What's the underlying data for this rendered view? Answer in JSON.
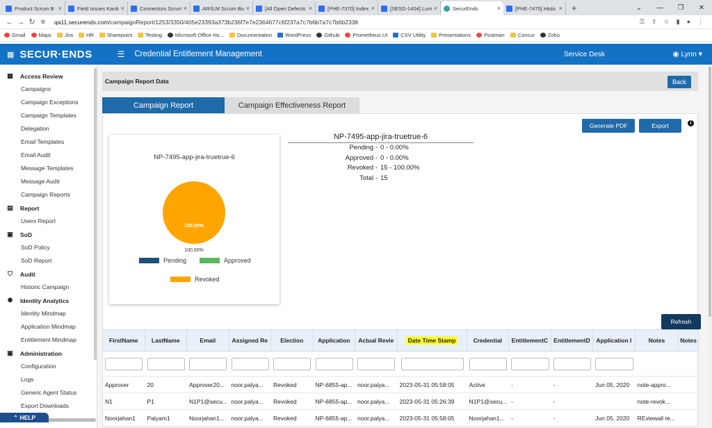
{
  "browser": {
    "tabs": [
      {
        "title": "Product Scrum B",
        "active": false
      },
      {
        "title": "Field Issues Kanb",
        "active": false
      },
      {
        "title": "Connectors Scrum",
        "active": false
      },
      {
        "title": "AR/ILM Scrum Bo",
        "active": false
      },
      {
        "title": "[All Open Defects",
        "active": false
      },
      {
        "title": "[PHE-7370] Index",
        "active": false
      },
      {
        "title": "[SESD-1404] Lum",
        "active": false
      },
      {
        "title": "SecurEnds",
        "active": true
      },
      {
        "title": "[PHE-7475] Histo",
        "active": false
      }
    ],
    "url_domain": "qa11.securends.com",
    "url_path": "/campaignReport/1253/3350/405e23393a373b236f7e7e2364677c6f237a7c7b6b7a7c7b6b2338",
    "bookmarks": [
      "Gmail",
      "Maps",
      "Jira",
      "HR",
      "Sharepoint",
      "Testing",
      "Microsoft Office Ho...",
      "Documentation",
      "WordPress",
      "Github",
      "Prometheus UI",
      "CSV Utility",
      "Presentations",
      "Postman",
      "Concur",
      "Zoho"
    ]
  },
  "header": {
    "logo": "SECUR·ENDS",
    "title": "Credential Entitlement Management",
    "service_desk": "Service Desk",
    "user": "Lynn"
  },
  "sidebar": {
    "sections": [
      {
        "label": "Access Review",
        "icon": "grid-icon",
        "items": [
          "Campaigns",
          "Campaign Exceptions",
          "Campaign Templates",
          "Delegation",
          "Email Templates",
          "Email Audit",
          "Message Templates",
          "Message Audit",
          "Campaign Reports"
        ]
      },
      {
        "label": "Report",
        "icon": "report-icon",
        "items": [
          "Users Report"
        ]
      },
      {
        "label": "SoD",
        "icon": "sod-icon",
        "items": [
          "SoD Policy",
          "SoD Report"
        ]
      },
      {
        "label": "Audit",
        "icon": "shield-icon",
        "items": [
          "Historic Campaign"
        ]
      },
      {
        "label": "Identity Analytics",
        "icon": "analytics-icon",
        "items": [
          "Identity Mindmap",
          "Application Mindmap",
          "Entitlement Mindmap"
        ]
      },
      {
        "label": "Administration",
        "icon": "admin-icon",
        "items": [
          "Configuration",
          "Logs",
          "Generic Agent Status",
          "Export Downloads"
        ]
      }
    ],
    "help": "HELP"
  },
  "page": {
    "section_title": "Campaign Report Data",
    "back_label": "Back",
    "tabs": [
      "Campaign Report",
      "Campaign Effectiveness Report"
    ],
    "generate_pdf": "Generate PDF",
    "export": "Export",
    "refresh": "Refresh"
  },
  "chart_data": {
    "type": "pie",
    "title": "NP-7495-app-jira-truetrue-6",
    "slices": [
      {
        "name": "Pending",
        "value": 0,
        "color": "#1f4e79"
      },
      {
        "name": "Approved",
        "value": 0,
        "color": "#5cb85c"
      },
      {
        "name": "Revoked",
        "value": 100,
        "color": "#ffa500"
      }
    ],
    "inner_label": "100.00%",
    "outer_label": "100.00%"
  },
  "summary": {
    "title": "NP-7495-app-jira-truetrue-6",
    "rows": [
      {
        "k": "Pending -",
        "v": "0 - 0.00%"
      },
      {
        "k": "Approved -",
        "v": "0 - 0.00%"
      },
      {
        "k": "Revoked -",
        "v": "15 - 100.00%"
      },
      {
        "k": "Total -",
        "v": "15"
      }
    ]
  },
  "table": {
    "columns": [
      "FirstName",
      "LastName",
      "Email",
      "Assigned Re",
      "Election",
      "Application",
      "Actual Revie",
      "Date Time Stamp",
      "Credential",
      "EntitlementC",
      "EntitlementD",
      "Application I",
      "Notes",
      "Notes"
    ],
    "rows": [
      [
        "Approver",
        "20",
        "Approver20...",
        "noor.palya...",
        "Revoked",
        "NP-6855-ap...",
        "noor.palya...",
        "2023-05-31 05:58:05",
        "Active",
        "-",
        "-",
        "Jun 05, 2020",
        "note-appro...",
        ""
      ],
      [
        "N1",
        "P1",
        "N1P1@secu...",
        "noor.palya...",
        "Revoked",
        "NP-6855-ap...",
        "noor.palya...",
        "2023-05-31 05:26:39",
        "N1P1@secu...",
        "-",
        "-",
        "",
        "note-revok...",
        ""
      ],
      [
        "Noorjahan1",
        "Palyam1",
        "Noorjahan1...",
        "noor.palya...",
        "Revoked",
        "NP-6855-ap...",
        "noor.palya...",
        "2023-05-31 05:58:05",
        "Noorjahan1...",
        "-",
        "-",
        "Jun 05, 2020",
        "REviewall re...",
        ""
      ]
    ]
  }
}
